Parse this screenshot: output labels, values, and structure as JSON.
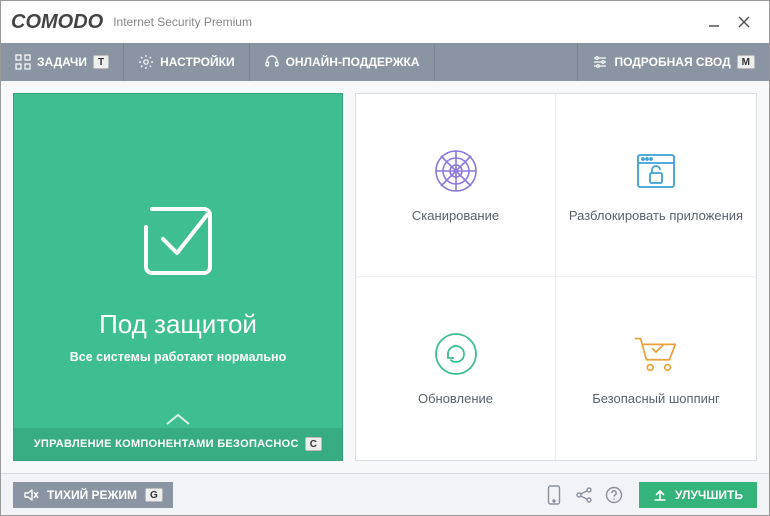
{
  "title": {
    "brand": "COMODO",
    "product": "Internet Security Premium"
  },
  "toolbar": {
    "tasks": {
      "label": "ЗАДАЧИ",
      "kbd": "T"
    },
    "settings": {
      "label": "НАСТРОЙКИ"
    },
    "support": {
      "label": "ОНЛАЙН-ПОДДЕРЖКА"
    },
    "summary": {
      "label": "ПОДРОБНАЯ СВОД",
      "kbd": "M"
    }
  },
  "status": {
    "title": "Под защитой",
    "subtitle": "Все системы работают нормально",
    "footer_label": "УПРАВЛЕНИЕ КОМПОНЕНТАМИ БЕЗОПАСНОС",
    "footer_kbd": "C"
  },
  "tiles": {
    "scan": "Сканирование",
    "unblock": "Разблокировать приложения",
    "update": "Обновление",
    "shopping": "Безопасный шоппинг"
  },
  "bottom": {
    "silent_label": "ТИХИЙ РЕЖИМ",
    "silent_kbd": "G",
    "upgrade": "УЛУЧШИТЬ"
  }
}
